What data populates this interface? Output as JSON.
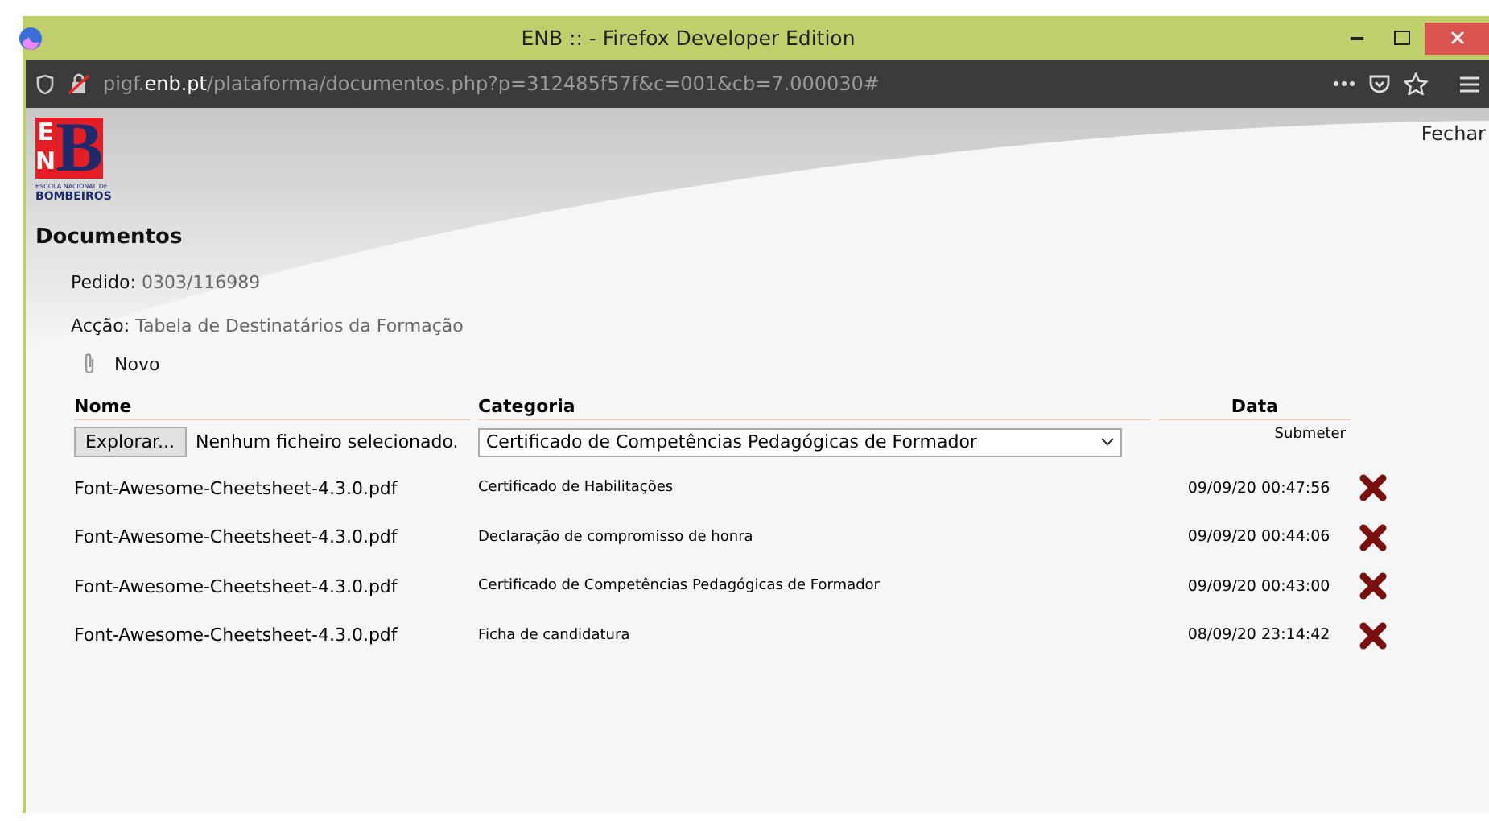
{
  "window": {
    "title": "ENB :: - Firefox Developer Edition"
  },
  "address_bar": {
    "url_prefix": "pigf.",
    "url_domain": "enb.pt",
    "url_path": "/plataforma/documentos.php?p=312485f57f&c=001&cb=7.000030#"
  },
  "logo": {
    "letters": [
      "E",
      "N",
      "B"
    ],
    "line_1": "ESCOLA NACIONAL DE",
    "line_2": "BOMBEIROS"
  },
  "close_link": "Fechar",
  "page_title": "Documentos",
  "fields": [
    {
      "label": "Pedido:",
      "value": "0303/116989"
    },
    {
      "label": "Acção:",
      "value": "Tabela de Destinatários da Formação"
    }
  ],
  "new_link": "Novo",
  "table": {
    "columns": [
      "Nome",
      "Categoria",
      "Data"
    ],
    "upload": {
      "browse_button": "Explorar...",
      "file_status": "Nenhum ficheiro selecionado.",
      "category": "Certificado de Competências Pedagógicas de Formador",
      "submit": "Submeter"
    },
    "rows": [
      {
        "name": "Font-Awesome-Cheetsheet-4.3.0.pdf",
        "category": "Certificado de Habilitações",
        "date": "09/09/20 00:47:56"
      },
      {
        "name": "Font-Awesome-Cheetsheet-4.3.0.pdf",
        "category": "Declaração de compromisso de honra",
        "date": "09/09/20 00:44:06"
      },
      {
        "name": "Font-Awesome-Cheetsheet-4.3.0.pdf",
        "category": "Certificado de Competências Pedagógicas de Formador",
        "date": "09/09/20 00:43:00"
      },
      {
        "name": "Font-Awesome-Cheetsheet-4.3.0.pdf",
        "category": "Ficha de candidatura",
        "date": "08/09/20 23:14:42"
      }
    ]
  }
}
